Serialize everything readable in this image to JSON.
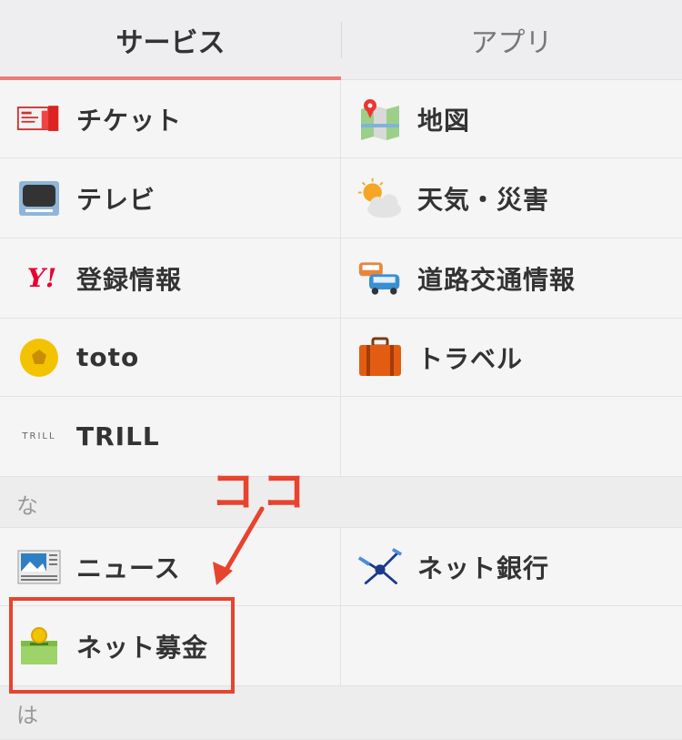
{
  "tabs": [
    {
      "label": "サービス",
      "active": true
    },
    {
      "label": "アプリ",
      "active": false
    }
  ],
  "rows": [
    {
      "left": {
        "label": "チケット",
        "icon": "ticket-icon"
      },
      "right": {
        "label": "地図",
        "icon": "map-icon"
      }
    },
    {
      "left": {
        "label": "テレビ",
        "icon": "tv-icon"
      },
      "right": {
        "label": "天気・災害",
        "icon": "weather-icon"
      }
    },
    {
      "left": {
        "label": "登録情報",
        "icon": "yahoo-logo-icon",
        "logo": "Y!"
      },
      "right": {
        "label": "道路交通情報",
        "icon": "traffic-cars-icon"
      }
    },
    {
      "left": {
        "label": "toto",
        "icon": "soccer-ball-icon"
      },
      "right": {
        "label": "トラベル",
        "icon": "suitcase-icon"
      }
    },
    {
      "left": {
        "label": "TRILL",
        "icon": "trill-logo-icon",
        "logo": "TRILL"
      },
      "right": {
        "label": "",
        "icon": ""
      }
    }
  ],
  "sections": {
    "na": "な",
    "ha": "は"
  },
  "rows2": [
    {
      "left": {
        "label": "ニュース",
        "icon": "news-icon"
      },
      "right": {
        "label": "ネット銀行",
        "icon": "satellite-icon"
      }
    },
    {
      "left": {
        "label": "ネット募金",
        "icon": "donation-box-icon"
      },
      "right": {
        "label": "",
        "icon": ""
      }
    }
  ],
  "annotation": {
    "text": "ココ",
    "color": "#e8432e"
  },
  "colors": {
    "tab_indicator": "#ef7a7a",
    "yahoo_red": "#e60033"
  }
}
